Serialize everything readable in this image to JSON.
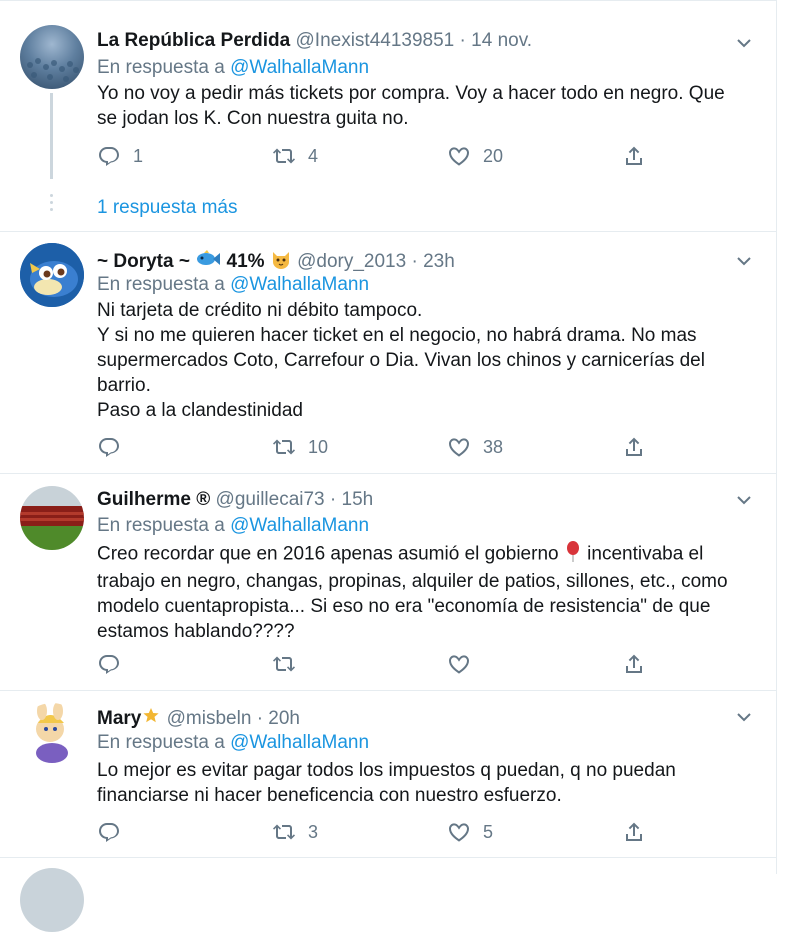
{
  "reply_prefix": "En respuesta a",
  "tweets": [
    {
      "name": "La República Perdida",
      "handle": "@Inexist44139851",
      "sep": "·",
      "time": "14 nov.",
      "reply_to": "@WalhallaMann",
      "lines": [
        "Yo no voy a pedir más tickets por compra. Voy a hacer todo en negro. Que",
        "se jodan los K. Con nuestra guita no."
      ],
      "replies": "1",
      "retweets": "4",
      "likes": "20"
    },
    {
      "name": "~ Doryta ~",
      "name_suffix": "41%",
      "handle": "@dory_2013",
      "sep": "·",
      "time": "23h",
      "reply_to": "@WalhallaMann",
      "lines": [
        "Ni tarjeta de crédito ni débito tampoco.",
        "Y si no me quieren hacer ticket en el negocio, no habrá drama. No mas",
        "supermercados Coto, Carrefour o Dia. Vivan los chinos y carnicerías del",
        "barrio.",
        "Paso a la clandestinidad"
      ],
      "replies": "",
      "retweets": "10",
      "likes": "38"
    },
    {
      "name": "Guilherme",
      "name_suffix": "®",
      "handle": "@guillecai73",
      "sep": "·",
      "time": "15h",
      "reply_to": "@WalhallaMann",
      "lines": [
        "Creo recordar que en 2016 apenas asumió el gobierno",
        "incentivaba el",
        "trabajo en negro, changas, propinas, alquiler de patios, sillones, etc., como",
        "modelo cuentapropista... Si eso no era \"economía de resistencia\" de que",
        "estamos hablando????"
      ],
      "replies": "",
      "retweets": "",
      "likes": ""
    },
    {
      "name": "Mary",
      "handle": "@misbeln",
      "sep": "·",
      "time": "20h",
      "reply_to": "@WalhallaMann",
      "lines": [
        "Lo mejor es evitar pagar todos los impuestos q puedan, q no puedan",
        "financiarse ni hacer beneficencia con nuestro esfuerzo."
      ],
      "replies": "",
      "retweets": "3",
      "likes": "5"
    }
  ],
  "more_replies": "1 respuesta más",
  "colors": {
    "accent": "#1b95e0",
    "muted": "#657786",
    "border": "#e6ecf0"
  },
  "icons": [
    "reply-icon",
    "retweet-icon",
    "like-icon",
    "share-icon",
    "chevron-down-icon",
    "fish-emoji-icon",
    "cat-emoji-icon",
    "balloon-emoji-icon",
    "dizzy-emoji-icon"
  ]
}
